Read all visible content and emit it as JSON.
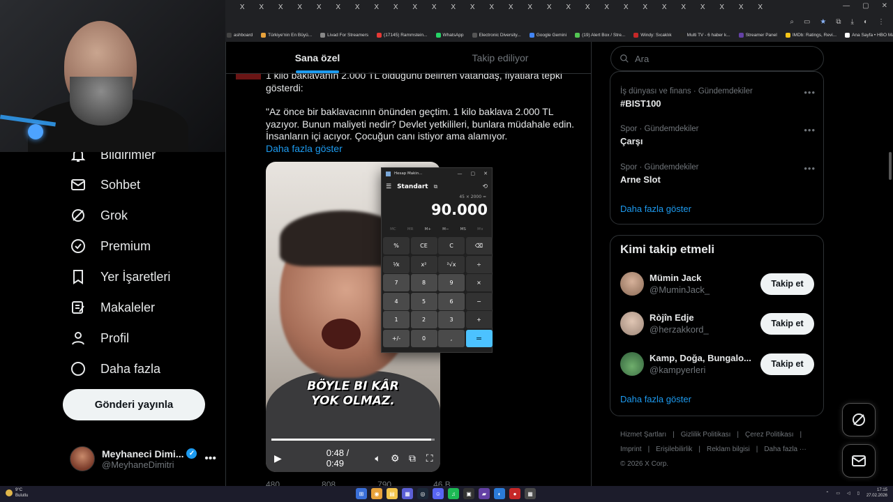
{
  "browser": {
    "tab_glyph": "X",
    "bookmarks": [
      {
        "label": "ashboard",
        "color": "#444"
      },
      {
        "label": "Türkiye'nin En Büyü...",
        "color": "#e8a23b"
      },
      {
        "label": "Livad For Streamers",
        "color": "#888"
      },
      {
        "label": "(17145) Rammstein...",
        "color": "#e53935"
      },
      {
        "label": "WhatsApp",
        "color": "#25d366"
      },
      {
        "label": "Electronic Diversity...",
        "color": "#555"
      },
      {
        "label": "Google Gemini",
        "color": "#4285f4"
      },
      {
        "label": "(19) Alert Box / Stre...",
        "color": "#53c653"
      },
      {
        "label": "Windy: Sıcaklık",
        "color": "#c62828"
      },
      {
        "label": "Multi TV - 6 haber k...",
        "color": "#222"
      },
      {
        "label": "Streamer Panel",
        "color": "#6441a5"
      },
      {
        "label": "IMDb: Ratings, Revi...",
        "color": "#f5c518"
      },
      {
        "label": "Ana Sayfa • HBO Max",
        "color": "#fff"
      }
    ],
    "bookmarks_more": "»",
    "all_bookmarks": "Tüm Yer İşaretleri"
  },
  "nav": {
    "items": [
      {
        "label": "Bildirimler",
        "icon": "bell-icon"
      },
      {
        "label": "Sohbet",
        "icon": "mail-icon"
      },
      {
        "label": "Grok",
        "icon": "grok-icon"
      },
      {
        "label": "Premium",
        "icon": "premium-icon"
      },
      {
        "label": "Yer İşaretleri",
        "icon": "bookmark-icon"
      },
      {
        "label": "Makaleler",
        "icon": "article-icon"
      },
      {
        "label": "Profil",
        "icon": "person-icon"
      },
      {
        "label": "Daha fazla",
        "icon": "more-circle-icon"
      }
    ],
    "post_button": "Gönderi yayınla"
  },
  "profile": {
    "name": "Meyhaneci Dimi...",
    "handle": "@MeyhaneDimitri",
    "more": "•••"
  },
  "main": {
    "tabs": [
      {
        "label": "Sana özel",
        "active": true
      },
      {
        "label": "Takip ediliyor",
        "active": false
      }
    ],
    "tweet": {
      "line1": "1 kilo baklavanın 2.000 TL olduğunu belirten vatandaş, fiyatlara tepki gösterdi:",
      "quote": "\"Az önce bir baklavacının önünden geçtim. 1 kilo baklava 2.000 TL yazıyor. Bunun maliyeti nedir? Devlet yetkilileri, bunlara müdahale edin. İnsanların içi acıyor. Çocuğun canı istiyor ama alamıyor.",
      "show_more": "Daha fazla göster"
    },
    "video": {
      "caption_line1": "BÖYLE BI KÂR",
      "caption_line2": "YOK OLMAZ.",
      "time": "0:48 / 0:49",
      "progress": 0.98
    },
    "actions": [
      "480",
      "808",
      "790",
      "46 B"
    ]
  },
  "calculator": {
    "title": "Hesap Makin...",
    "mode": "Standart",
    "expression": "45 × 2000 =",
    "display": "90.000",
    "memory": [
      "MC",
      "MR",
      "M+",
      "M−",
      "MS",
      "M∨"
    ],
    "keys": [
      "%",
      "CE",
      "C",
      "⌫",
      "⅟x",
      "x²",
      "²√x",
      "÷",
      "7",
      "8",
      "9",
      "×",
      "4",
      "5",
      "6",
      "−",
      "1",
      "2",
      "3",
      "+",
      "+/-",
      "0",
      ",",
      "="
    ]
  },
  "right": {
    "search_placeholder": "Ara",
    "trends": [
      {
        "category": "İş dünyası ve finans · Gündemdekiler",
        "topic": "#BIST100"
      },
      {
        "category": "Spor · Gündemdekiler",
        "topic": "Çarşı"
      },
      {
        "category": "Spor · Gündemdekiler",
        "topic": "Arne Slot"
      }
    ],
    "trends_more": "Daha fazla göster",
    "who_title": "Kimi takip etmeli",
    "who": [
      {
        "name": "Mümin Jack",
        "handle": "@MuminJack_",
        "button": "Takip et",
        "avatar_color": "#8a6a55"
      },
      {
        "name": "Ròjîn Edje",
        "handle": "@herzakkord_",
        "button": "Takip et",
        "avatar_color": "#9c8577"
      },
      {
        "name": "Kamp, Doğa, Bungalo...",
        "handle": "@kampyerleri",
        "button": "Takip et",
        "avatar_color": "#3f7a4a"
      }
    ],
    "who_more": "Daha fazla göster",
    "footer": {
      "row1": [
        "Hizmet Şartları",
        "Gizlilik Politikası",
        "Çerez Politikası"
      ],
      "row2": [
        "Imprint",
        "Erişilebilirlik",
        "Reklam bilgisi",
        "Daha fazla ···"
      ],
      "copyright": "© 2026 X Corp."
    }
  },
  "taskbar": {
    "weather_temp": "9°C",
    "weather_desc": "Bulutlu",
    "time": "17:15",
    "date": "27.02.2026"
  }
}
